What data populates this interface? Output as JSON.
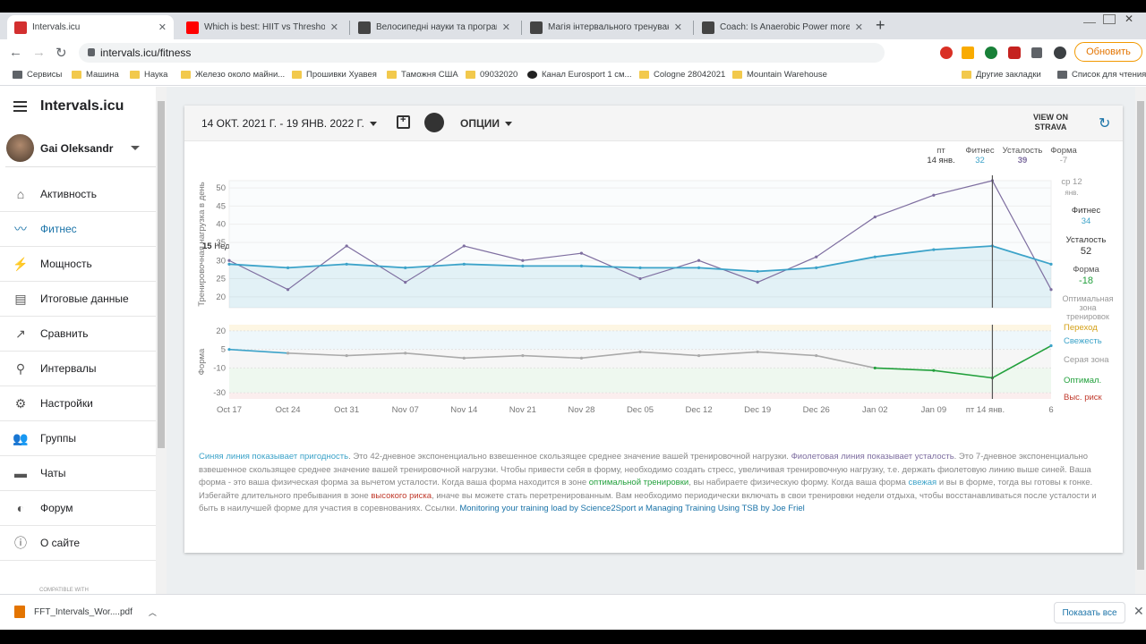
{
  "browser": {
    "tabs": [
      {
        "title": "Intervals.icu",
        "color": "#d32f2f"
      },
      {
        "title": "Which is best: HIIT vs Threshold vs",
        "color": "#ff0000"
      },
      {
        "title": "Велосипедні науки та програми д",
        "color": "#444444"
      },
      {
        "title": "Магія інтервального тренування (",
        "color": "#444444"
      },
      {
        "title": "Coach: Is Anaerobic Power more tra",
        "color": "#444444"
      }
    ],
    "new_tab": "+",
    "url": "intervals.icu/fitness",
    "update_label": "Обновить",
    "bookmarks": [
      "Сервисы",
      "Машина",
      "Наука",
      "Железо около майни...",
      "Прошивки Хуавея",
      "Таможня США",
      "09032020",
      "Канал Eurosport 1 см...",
      "Cologne 28042021",
      "Mountain Warehouse",
      "Другие закладки",
      "Список для чтения"
    ]
  },
  "sidebar": {
    "brand": "Intervals.icu",
    "user": "Gai Oleksandr",
    "items": [
      {
        "label": "Активность",
        "icon": "home-icon"
      },
      {
        "label": "Фитнес",
        "icon": "trend-icon"
      },
      {
        "label": "Мощность",
        "icon": "bolt-icon"
      },
      {
        "label": "Итоговые данные",
        "icon": "summary-icon"
      },
      {
        "label": "Сравнить",
        "icon": "compare-icon"
      },
      {
        "label": "Интервалы",
        "icon": "search-icon"
      },
      {
        "label": "Настройки",
        "icon": "gear-icon"
      },
      {
        "label": "Группы",
        "icon": "group-icon"
      },
      {
        "label": "Чаты",
        "icon": "chat-icon"
      },
      {
        "label": "Форум",
        "icon": "forum-icon"
      },
      {
        "label": "О сайте",
        "icon": "info-icon"
      }
    ],
    "compatible": "COMPATIBLE WITH"
  },
  "header": {
    "date_range": "14 ОКТ. 2021 Г. - 19 ЯНВ. 2022 Г.",
    "options": "ОПЦИИ",
    "strava_line1": "VIEW ON",
    "strava_line2": "STRAVA"
  },
  "summary": {
    "weeks_num": "15",
    "weeks_label": "Недели",
    "day": "пт",
    "date": "14 янв.",
    "fitness_label": "Фитнес",
    "fitness": "32",
    "fatigue_label": "Усталость",
    "fatigue": "39",
    "form_label": "Форма",
    "form": "-7"
  },
  "right_panel": {
    "date_line1": "ср 12",
    "date_line2": "янв.",
    "fitness_label": "Фитнес",
    "fitness": "34",
    "fatigue_label": "Усталость",
    "fatigue": "52",
    "form_label": "Форма",
    "form": "-18",
    "zone_line1": "Оптимальная",
    "zone_line2": "зона",
    "zone_line3": "тренировок",
    "zones": [
      "Переход",
      "Свежесть",
      "Серая зона",
      "Оптимал.",
      "Выс. риск"
    ]
  },
  "colors": {
    "fitness": "#3ca3c9",
    "fatigue": "#7e6ea0",
    "form_fresh": "#3ca3c9",
    "form_optimal": "#22a03c",
    "high_risk": "#c0392b",
    "transition": "#d4a017"
  },
  "chart_data": [
    {
      "type": "line",
      "ylabel": "Тренировочная нагрузка в день",
      "ylim": [
        17,
        52
      ],
      "yticks": [
        20,
        25,
        30,
        35,
        40,
        45,
        50
      ],
      "x": [
        "Oct 17",
        "Oct 24",
        "Oct 31",
        "Nov 07",
        "Nov 14",
        "Nov 21",
        "Nov 28",
        "Dec 05",
        "Dec 12",
        "Dec 19",
        "Dec 26",
        "Jan 02",
        "Jan 09",
        "пт 14 янв.",
        "6"
      ],
      "series": [
        {
          "name": "Фитнес",
          "values": [
            29,
            28,
            29,
            28,
            29,
            28.5,
            28.5,
            28,
            28,
            27,
            28,
            31,
            33,
            34,
            29
          ]
        },
        {
          "name": "Усталость",
          "values": [
            30,
            22,
            34,
            24,
            34,
            30,
            32,
            25,
            30,
            24,
            31,
            42,
            48,
            52,
            22
          ]
        }
      ],
      "grid": true
    },
    {
      "type": "line",
      "ylabel": "Форма",
      "ylim": [
        -35,
        25
      ],
      "yticks": [
        20,
        5,
        -10,
        -30
      ],
      "x": [
        "Oct 17",
        "Oct 24",
        "Oct 31",
        "Nov 07",
        "Nov 14",
        "Nov 21",
        "Nov 28",
        "Dec 05",
        "Dec 12",
        "Dec 19",
        "Dec 26",
        "Jan 02",
        "Jan 09",
        "пт 14 янв.",
        "6"
      ],
      "series": [
        {
          "name": "Форма",
          "values": [
            5,
            2,
            0,
            2,
            -2,
            0,
            -2,
            3,
            0,
            3,
            0,
            -10,
            -12,
            -18,
            8
          ]
        }
      ],
      "grid": true
    }
  ],
  "description": {
    "p1": "Синяя линия показывает пригодность",
    "p2": ". Это 42-дневное экспоненциально взвешенное скользящее среднее значение вашей тренировочной нагрузки. ",
    "p3": "Фиолетовая линия показывает усталость",
    "p4": ". Это 7-дневное экспоненциально взвешенное скользящее среднее значение вашей тренировочной нагрузки. Чтобы привести себя в форму, необходимо создать стресс, увеличивая тренировочную нагрузку, т.е. держать фиолетовую линию выше синей. Ваша форма - это ваша физическая форма за вычетом усталости. Когда ваша форма находится в зоне ",
    "p5": "оптимальной тренировки",
    "p6": ", вы набираете физическую форму. Когда ваша форма ",
    "p7": "свежая",
    "p8": " и вы в форме, тогда вы готовы к гонке. Избегайте длительного пребывания в зоне ",
    "p9": "высокого риска",
    "p10": ", иначе вы можете стать перетренированным. Вам необходимо периодически включать в свои тренировки недели отдыха, чтобы восстанавливаться после усталости и быть в наилучшей форме для участия в соревнованиях. Ссылки. ",
    "link1": "Monitoring your training load by Science2Sport",
    "and": " и ",
    "link2": "Managing Training Using TSB by Joe Friel"
  },
  "downloads": {
    "file": "FFT_Intervals_Wor....pdf",
    "show_all": "Показать все"
  }
}
